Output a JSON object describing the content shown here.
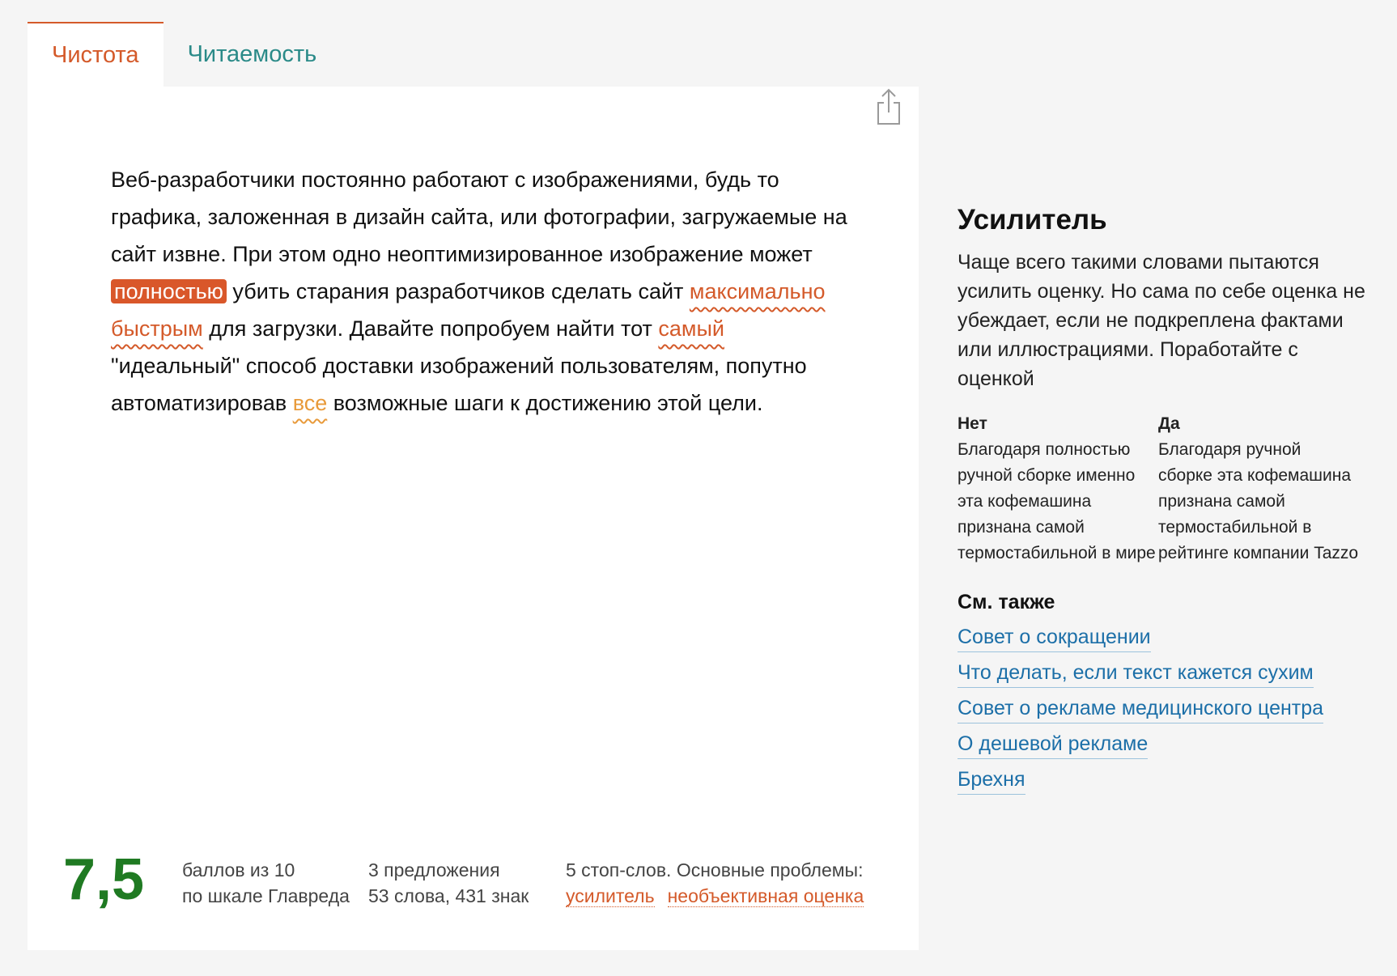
{
  "tabs": [
    {
      "label": "Чистота",
      "active": true
    },
    {
      "label": "Читаемость",
      "active": false
    }
  ],
  "icons": {
    "share": "share-icon"
  },
  "text": {
    "p1": "Веб-разработчики постоянно работают с изображениями, будь то графика, заложенная в дизайн сайта, или фотографии, загружаемые на сайт извне. При этом одно неоптимизированное изображение может ",
    "w1": "полностью",
    "p2": " убить старания разработчиков сделать сайт ",
    "w2": "максимально",
    "p3": " ",
    "w3": "быстрым",
    "p4": " для загрузки. Давайте попробуем найти тот ",
    "w4": "самый",
    "p5": " \"идеальный\" способ доставки изображений пользователям, попутно автоматизировав ",
    "w5": "все",
    "p6": " возможные шаги к достижению этой цели."
  },
  "stats": {
    "score": "7,5",
    "score_line1": "баллов из 10",
    "score_line2": "по шкале Главреда",
    "sentences": "3 предложения",
    "words_chars": "53 слова, 431 знак",
    "stopwords": "5 стоп-слов. Основные проблемы:",
    "problems": [
      "усилитель",
      "необъективная оценка"
    ]
  },
  "sidebar": {
    "title": "Усилитель",
    "description": "Чаще всего такими словами пытаются усилить оценку. Но сама по себе оценка не убеждает, если не подкреплена фактами или иллюстрациями. Поработайте с оценкой",
    "no_label": "Нет",
    "no_text": "Благодаря полностью ручной сборке именно эта кофемашина признана самой термостабильной в мире",
    "yes_label": "Да",
    "yes_text": "Благодаря ручной сборке эта кофемашина признана самой термостабильной в рейтинге компании Tazzo",
    "see_also_title": "См. также",
    "links": [
      "Совет о сокращении",
      "Что делать, если текст кажется сухим",
      "Совет о рекламе медицинского центра",
      "О дешевой рекламе",
      "Брехня"
    ]
  },
  "colors": {
    "accent": "#d45a2a",
    "highlight": "#d9572a",
    "weak_highlight": "#e89a3a",
    "score": "#1f7a22",
    "link": "#1c6fa8",
    "tab_inactive": "#2a8a88"
  }
}
